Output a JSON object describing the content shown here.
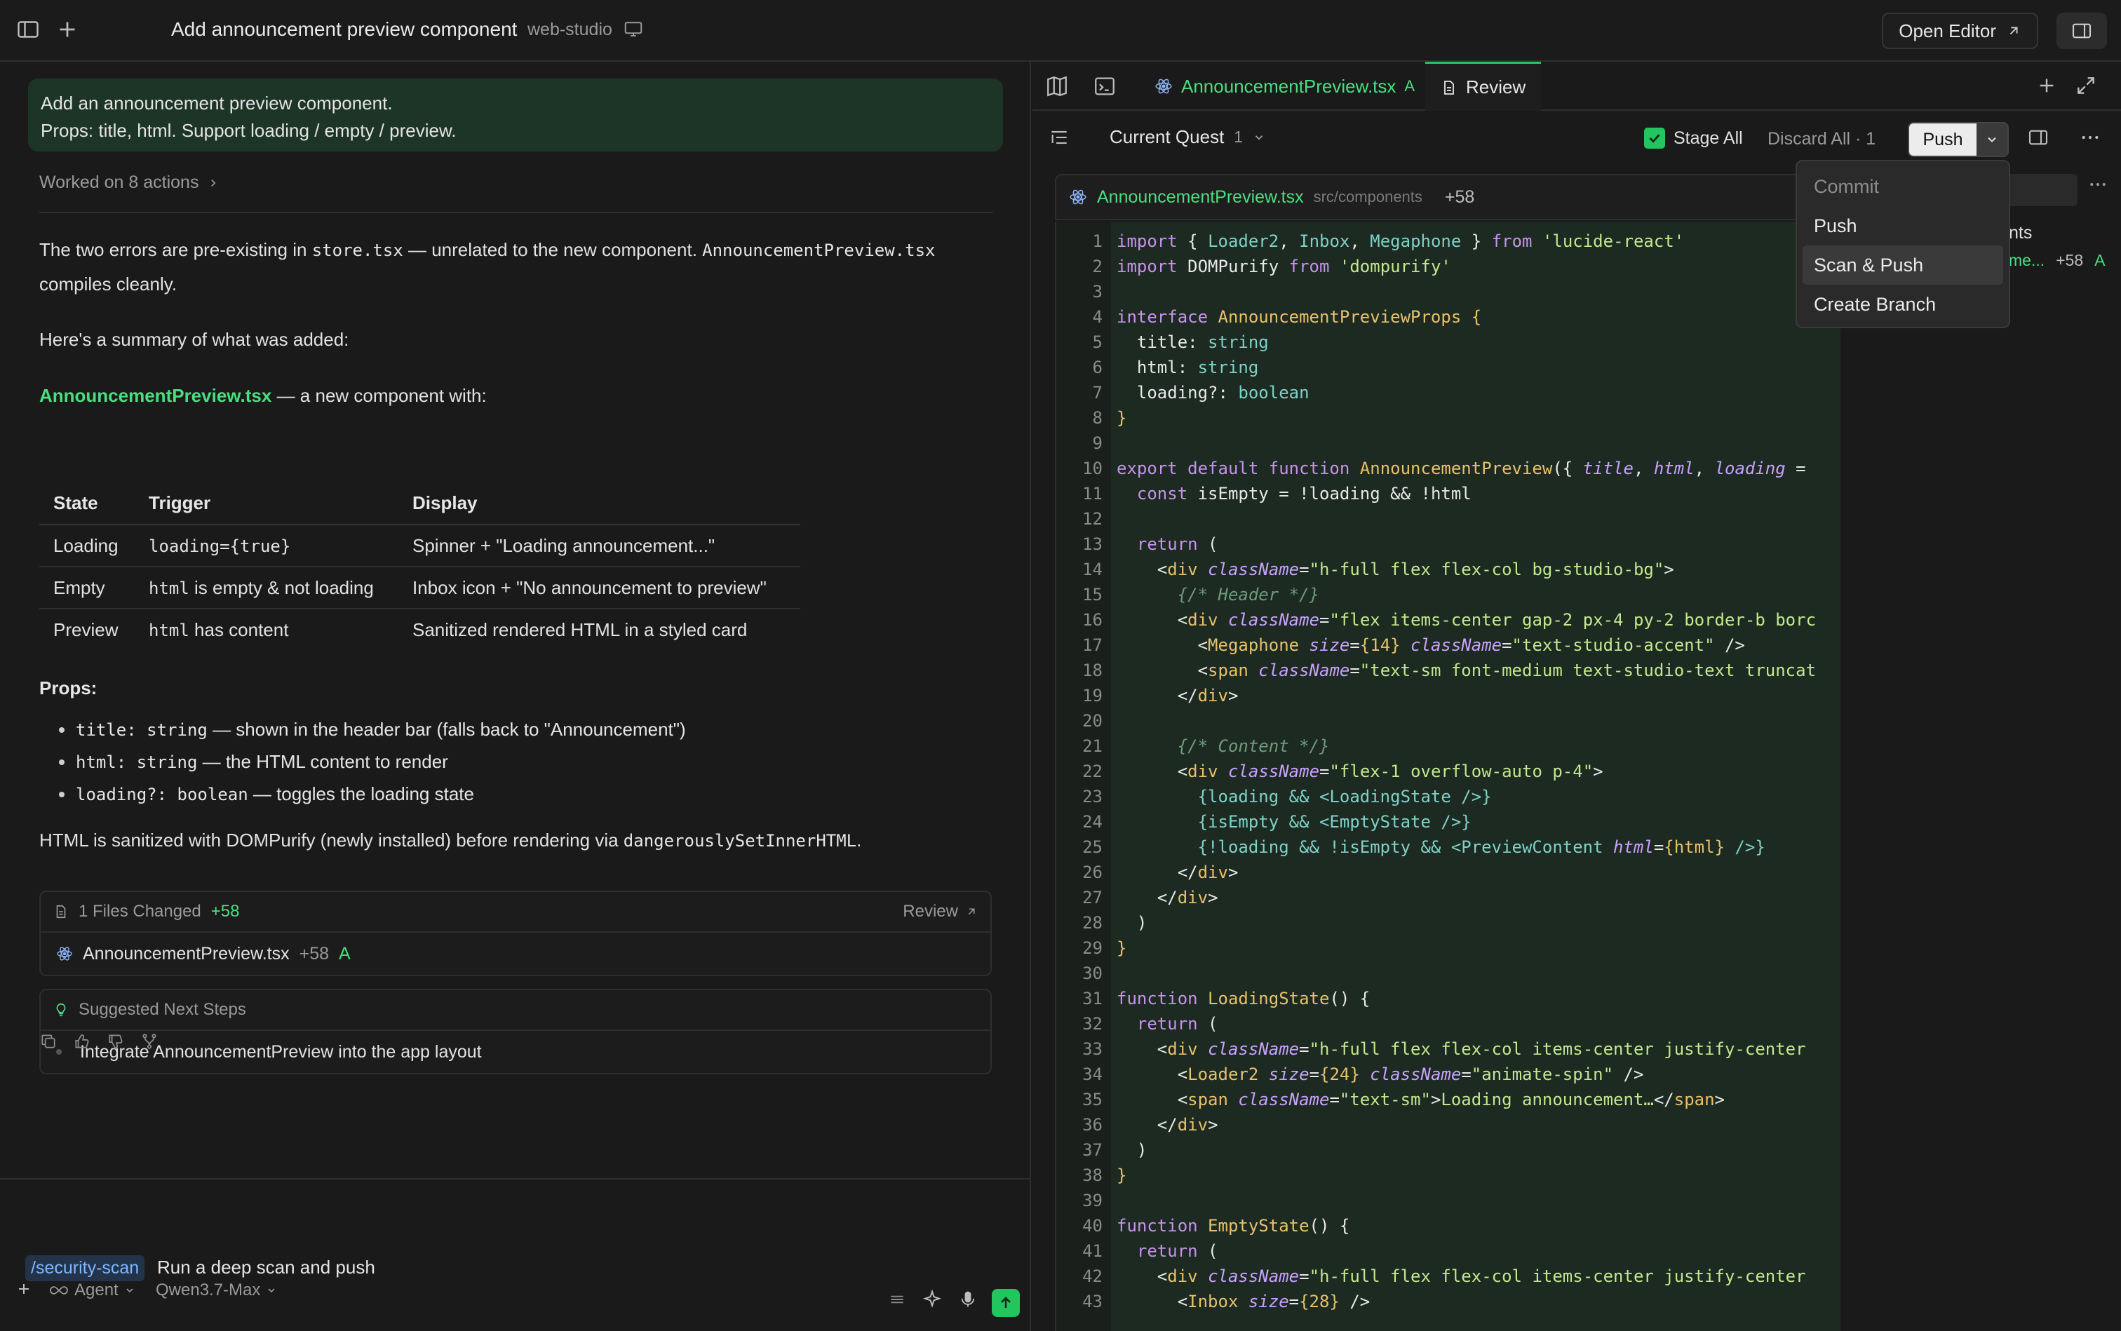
{
  "header": {
    "task_title": "Add announcement preview component",
    "project": "web-studio",
    "open_editor_label": "Open Editor"
  },
  "chat": {
    "prompt_line1": "Add an announcement preview component.",
    "prompt_line2": "Props: title, html. Support loading / empty / preview.",
    "worked_label": "Worked on 8 actions",
    "p1_a": "The two errors are pre-existing in ",
    "p1_code1": "store.tsx",
    "p1_b": " — unrelated to the new component. ",
    "p1_code2": "AnnouncementPreview.tsx",
    "p1_c": "compiles cleanly.",
    "p2": "Here's a summary of what was added:",
    "p3_link": "AnnouncementPreview.tsx",
    "p3_rest": " — a new component with:",
    "table": {
      "headers": [
        "State",
        "Trigger",
        "Display"
      ],
      "rows": [
        {
          "state": "Loading",
          "trigger_code": "loading={true}",
          "trigger_rest": "",
          "display": "Spinner + \"Loading announcement...\""
        },
        {
          "state": "Empty",
          "trigger_code": "html",
          "trigger_rest": " is empty & not loading",
          "display": "Inbox icon + \"No announcement to preview\""
        },
        {
          "state": "Preview",
          "trigger_code": "html",
          "trigger_rest": " has content",
          "display": "Sanitized rendered HTML in a styled card"
        }
      ]
    },
    "props_heading": "Props:",
    "props": [
      {
        "code": "title: string",
        "text": " — shown in the header bar (falls back to \"Announcement\")"
      },
      {
        "code": "html: string",
        "text": " — the HTML content to render"
      },
      {
        "code": "loading?: boolean",
        "text": " — toggles the loading state"
      }
    ],
    "p4_a": "HTML is sanitized with DOMPurify (newly installed) before rendering via ",
    "p4_code": "dangerouslySetInnerHTML",
    "p4_b": ".",
    "files_card": {
      "title": "1 Files Changed",
      "plus": "+58",
      "review_label": "Review",
      "file_name": "AnnouncementPreview.tsx",
      "file_plus": "+58",
      "file_status": "A"
    },
    "next_steps": {
      "title": "Suggested Next Steps",
      "item": "Integrate AnnouncementPreview into the app layout"
    },
    "composer": {
      "command": "/security-scan",
      "text": "Run a deep scan and push",
      "mode": "Agent",
      "model": "Qwen3.7-Max"
    }
  },
  "editor": {
    "tab_file": "AnnouncementPreview.tsx",
    "tab_file_status": "A",
    "tab_review": "Review",
    "quest_label": "Current Quest",
    "quest_count": "1",
    "stage_all": "Stage All",
    "discard_all": "Discard All · 1",
    "push_label": "Push",
    "file_header": {
      "name": "AnnouncementPreview.tsx",
      "path": "src/components",
      "plus": "+58"
    },
    "menu": {
      "heading": "Commit",
      "items": [
        "Push",
        "Scan & Push",
        "Create Branch"
      ]
    },
    "side_text1": "nts",
    "side_text2": "me...",
    "side_plus": "+58",
    "side_status": "A"
  },
  "colors": {
    "accent_green": "#22c55e",
    "prompt_bg": "#1d3526",
    "code_bg": "#1c2a22"
  }
}
